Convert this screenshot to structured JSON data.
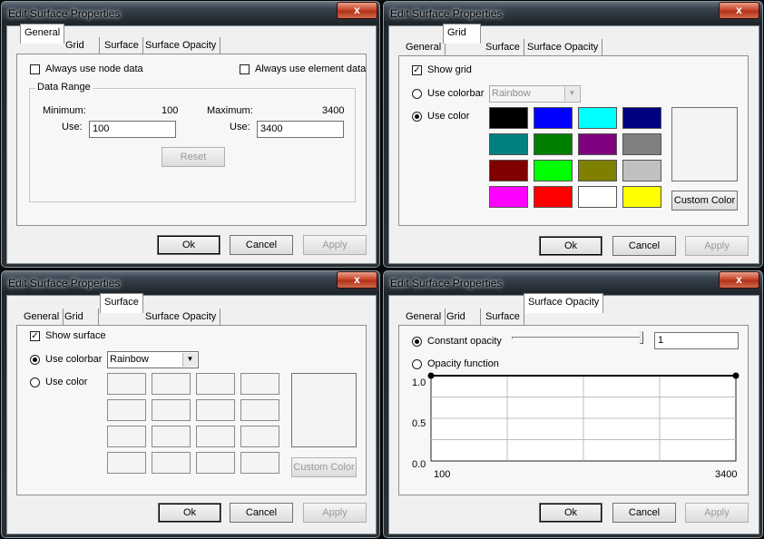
{
  "dialog_title": "Edit Surface Properties",
  "close_glyph": "x",
  "tabs": [
    "General",
    "Grid",
    "Surface",
    "Surface Opacity"
  ],
  "buttons": {
    "ok": "Ok",
    "cancel": "Cancel",
    "apply": "Apply"
  },
  "general": {
    "always_node": "Always use node data",
    "always_element": "Always use element data",
    "data_range_label": "Data Range",
    "minimum_label": "Minimum:",
    "minimum_value": "100",
    "maximum_label": "Maximum:",
    "maximum_value": "3400",
    "use_label": "Use:",
    "use_min_value": "100",
    "use_max_value": "3400",
    "reset": "Reset"
  },
  "grid": {
    "show_grid": "Show grid",
    "show_grid_checked": true,
    "use_colorbar": "Use colorbar",
    "colorbar_value": "Rainbow",
    "use_color": "Use color",
    "selected_mode": "use_color",
    "swatch_colors": [
      "#000000",
      "#0000ff",
      "#00ffff",
      "#000080",
      "#008080",
      "#008000",
      "#800080",
      "#808080",
      "#800000",
      "#00ff00",
      "#808000",
      "#c0c0c0",
      "#ff00ff",
      "#ff0000",
      "#ffffff",
      "#ffff00"
    ],
    "custom_color": "Custom Color"
  },
  "surface": {
    "show_surface": "Show surface",
    "show_surface_checked": true,
    "use_colorbar": "Use colorbar",
    "colorbar_value": "Rainbow",
    "use_color": "Use color",
    "selected_mode": "use_colorbar",
    "custom_color": "Custom Color"
  },
  "opacity": {
    "constant_opacity": "Constant opacity",
    "constant_value": "1",
    "slider_level": 1.0,
    "opacity_function": "Opacity function",
    "selected_mode": "constant",
    "y_labels": [
      "1.0",
      "0.5",
      "0.0"
    ],
    "x_min": "100",
    "x_max": "3400"
  }
}
